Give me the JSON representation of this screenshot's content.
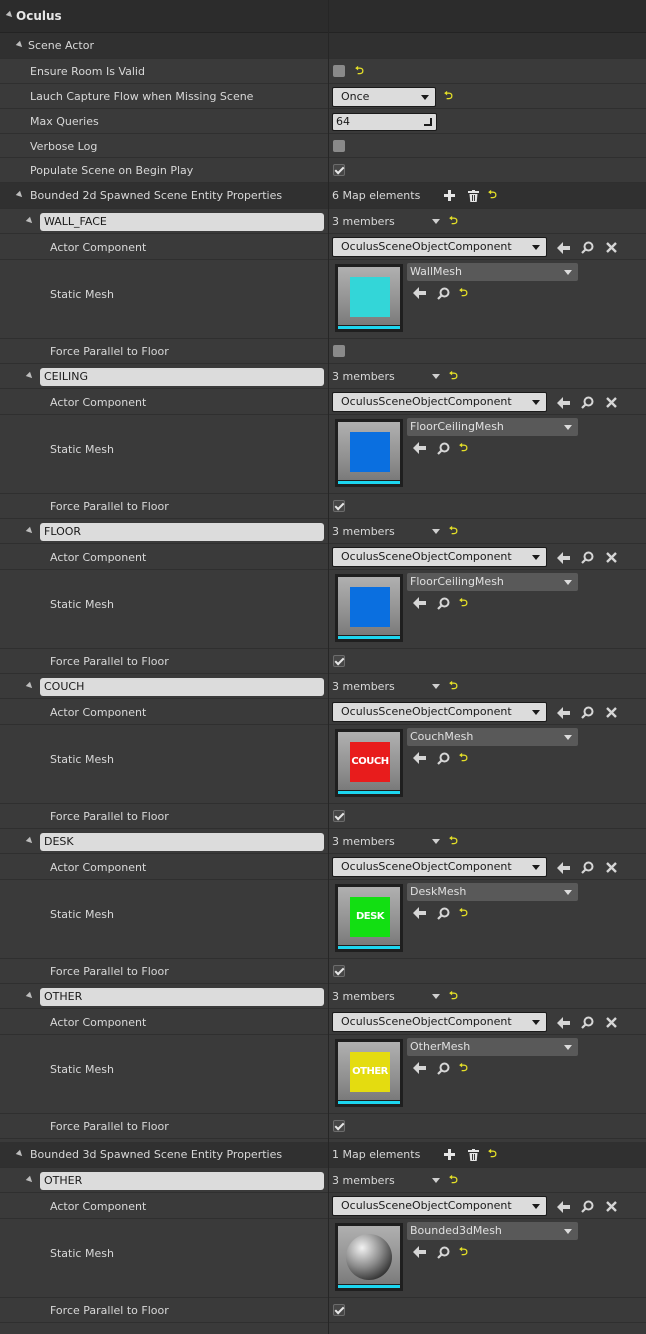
{
  "category": "Oculus",
  "section": "Scene Actor",
  "props": {
    "ensure_room": "Ensure Room Is Valid",
    "launch_capture": "Lauch Capture Flow when Missing Scene",
    "launch_capture_value": "Once",
    "max_queries": "Max Queries",
    "max_queries_value": "64",
    "verbose_log": "Verbose Log",
    "populate_scene": "Populate Scene on Begin Play"
  },
  "checkboxes": {
    "ensure_room": false,
    "verbose_log": false,
    "populate_scene": true
  },
  "map_2d": {
    "label": "Bounded 2d Spawned Scene Entity Properties",
    "count_text": "6 Map elements",
    "entries": [
      {
        "key": "WALL_FACE",
        "members": "3 members",
        "actor_component_label": "Actor Component",
        "actor_component": "OculusSceneObjectComponent",
        "static_mesh_label": "Static Mesh",
        "mesh": "WallMesh",
        "thumb_color": "#33d6d8",
        "thumb_text": "",
        "force_parallel_label": "Force Parallel to Floor",
        "force_parallel": false
      },
      {
        "key": "CEILING",
        "members": "3 members",
        "actor_component_label": "Actor Component",
        "actor_component": "OculusSceneObjectComponent",
        "static_mesh_label": "Static Mesh",
        "mesh": "FloorCeilingMesh",
        "thumb_color": "#0a6fe0",
        "thumb_text": "",
        "force_parallel_label": "Force Parallel to Floor",
        "force_parallel": true
      },
      {
        "key": "FLOOR",
        "members": "3 members",
        "actor_component_label": "Actor Component",
        "actor_component": "OculusSceneObjectComponent",
        "static_mesh_label": "Static Mesh",
        "mesh": "FloorCeilingMesh",
        "thumb_color": "#0a6fe0",
        "thumb_text": "",
        "force_parallel_label": "Force Parallel to Floor",
        "force_parallel": true
      },
      {
        "key": "COUCH",
        "members": "3 members",
        "actor_component_label": "Actor Component",
        "actor_component": "OculusSceneObjectComponent",
        "static_mesh_label": "Static Mesh",
        "mesh": "CouchMesh",
        "thumb_color": "#e81c1c",
        "thumb_text": "COUCH",
        "force_parallel_label": "Force Parallel to Floor",
        "force_parallel": true
      },
      {
        "key": "DESK",
        "members": "3 members",
        "actor_component_label": "Actor Component",
        "actor_component": "OculusSceneObjectComponent",
        "static_mesh_label": "Static Mesh",
        "mesh": "DeskMesh",
        "thumb_color": "#12df12",
        "thumb_text": "DESK",
        "force_parallel_label": "Force Parallel to Floor",
        "force_parallel": true
      },
      {
        "key": "OTHER",
        "members": "3 members",
        "actor_component_label": "Actor Component",
        "actor_component": "OculusSceneObjectComponent",
        "static_mesh_label": "Static Mesh",
        "mesh": "OtherMesh",
        "thumb_color": "#e4dc10",
        "thumb_text": "OTHER",
        "force_parallel_label": "Force Parallel to Floor",
        "force_parallel": true
      }
    ]
  },
  "map_3d": {
    "label": "Bounded 3d Spawned Scene Entity Properties",
    "count_text": "1 Map elements",
    "entries": [
      {
        "key": "OTHER",
        "members": "3 members",
        "actor_component_label": "Actor Component",
        "actor_component": "OculusSceneObjectComponent",
        "static_mesh_label": "Static Mesh",
        "mesh": "Bounded3dMesh",
        "thumb_color": "",
        "thumb_text": "",
        "thumb_kind": "sphere",
        "force_parallel_label": "Force Parallel to Floor",
        "force_parallel": true
      }
    ]
  },
  "colors": {
    "reset_arrow": "#e5e028",
    "thumb_bar": "#1cd6f0",
    "panel_bg": "#3a3a3a"
  }
}
